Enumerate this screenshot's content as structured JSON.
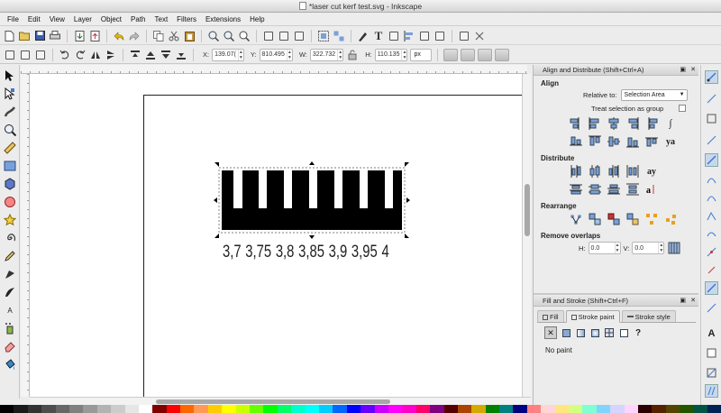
{
  "window": {
    "title": "*laser cut kerf test.svg - Inkscape"
  },
  "menu": [
    "File",
    "Edit",
    "View",
    "Layer",
    "Object",
    "Path",
    "Text",
    "Filters",
    "Extensions",
    "Help"
  ],
  "controls": {
    "x_label": "X:",
    "x_value": "139.07(",
    "y_label": "Y:",
    "y_value": "810.495",
    "w_label": "W:",
    "w_value": "322.732",
    "h_label": "H:",
    "h_value": "110.135",
    "unit": "px"
  },
  "canvas": {
    "labels": [
      "3,7",
      "3,75",
      "3,8",
      "3,85",
      "3,9",
      "3,95",
      "4"
    ]
  },
  "align_panel": {
    "title": "Align and Distribute (Shift+Ctrl+A)",
    "align_heading": "Align",
    "relative_to_label": "Relative to:",
    "relative_to_value": "Selection Area",
    "treat_as_group": "Treat selection as group",
    "distribute_heading": "Distribute",
    "rearrange_heading": "Rearrange",
    "remove_overlaps_heading": "Remove overlaps",
    "h_label": "H:",
    "h_value": "0.0",
    "v_label": "V:",
    "v_value": "0.0",
    "text_align_glyph": "ya",
    "text_distribute_glyph": "ay"
  },
  "fill_panel": {
    "title": "Fill and Stroke (Shift+Ctrl+F)",
    "tab_fill": "Fill",
    "tab_stroke_paint": "Stroke paint",
    "tab_stroke_style": "Stroke style",
    "no_paint": "No paint",
    "unknown_glyph": "?"
  },
  "colors": {
    "accent": "#3a78d6",
    "palette": [
      "#000000",
      "#1a1a1a",
      "#333333",
      "#4d4d4d",
      "#666666",
      "#808080",
      "#999999",
      "#b3b3b3",
      "#cccccc",
      "#e6e6e6",
      "#ffffff",
      "#800000",
      "#ff0000",
      "#ff6600",
      "#ff9955",
      "#ffcc00",
      "#ffff00",
      "#ccff00",
      "#66ff00",
      "#00ff00",
      "#00ff66",
      "#00ffcc",
      "#00ffff",
      "#00ccff",
      "#0066ff",
      "#0000ff",
      "#6600ff",
      "#cc00ff",
      "#ff00ff",
      "#ff00cc",
      "#ff0066",
      "#800080",
      "#550000",
      "#aa4400",
      "#d4aa00",
      "#008000",
      "#008080",
      "#000080",
      "#ff8080",
      "#ffd5d5",
      "#ffe680",
      "#d5ff80",
      "#80ffd5",
      "#80d5ff",
      "#d5d5ff",
      "#ffd5ff",
      "#2b0000",
      "#552200",
      "#554400",
      "#225500",
      "#005544",
      "#002255"
    ]
  }
}
